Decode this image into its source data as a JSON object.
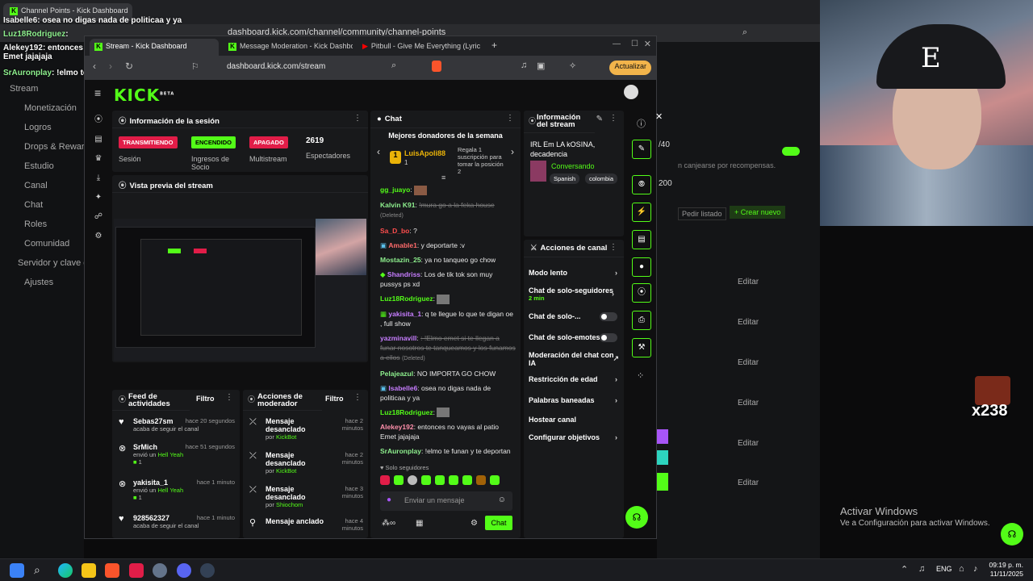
{
  "back_browser": {
    "tab_title": "Channel Points - Kick Dashboard",
    "url": "dashboard.kick.com/channel/community/channel-points"
  },
  "bg_sidebar": {
    "items": [
      "Stream",
      "Monetización",
      "Logros",
      "Drops & Rewards",
      "Estudio",
      "Canal",
      "Chat",
      "Roles",
      "Comunidad",
      "Servidor y clave de",
      "Ajustes"
    ]
  },
  "bg_right": {
    "count1": "/40",
    "count2": "200",
    "hint": "n canjearse por recompensas.",
    "pedir": "Pedir listado",
    "crear": "+ Crear nuevo",
    "editar": [
      "Editar",
      "Editar",
      "Editar",
      "Editar",
      "Editar",
      "Editar"
    ]
  },
  "overlay_chat": [
    {
      "user": "Isabelle6",
      "text": ": osea no digas nada de politicaa y ya"
    },
    {
      "user": "Luz18Rodriguez",
      "text": ":"
    },
    {
      "user": "Alekey192",
      "text": ": entonces no vayas al patio Emet jajajaja"
    },
    {
      "user": "SrAuronplay",
      "text": ": !elmo te funan y te deportan"
    }
  ],
  "front_browser": {
    "tabs": [
      "Stream - Kick Dashboard",
      "Message Moderation - Kick Dashboa",
      "Pitbull - Give Me Everything (Lyric"
    ],
    "url": "dashboard.kick.com/stream",
    "update": "Actualizar"
  },
  "session": {
    "title": "Información de la sesión",
    "stats": [
      {
        "badge": "TRANSMITIENDO",
        "label": "Sesión",
        "color": "#e11d48"
      },
      {
        "badge": "ENCENDIDO",
        "label": "Ingresos de Socio",
        "color": "#53fc18"
      },
      {
        "badge": "APAGADO",
        "label": "Multistream",
        "color": "#e11d48"
      },
      {
        "badge": "2619",
        "label": "Espectadores",
        "color": ""
      }
    ]
  },
  "preview": {
    "title": "Vista previa del stream"
  },
  "feed": {
    "title": "Feed de actividades",
    "filter": "Filtro",
    "items": [
      {
        "name": "Sebas27sm",
        "time": "hace 20 segundos",
        "desc": "acaba de seguir el canal",
        "extra": ""
      },
      {
        "name": "SrMich",
        "time": "hace 51 segundos",
        "desc": "envió un",
        "extra": "Hell Yeah",
        "count": "1"
      },
      {
        "name": "yakisita_1",
        "time": "hace 1 minuto",
        "desc": "envió un",
        "extra": "Hell Yeah",
        "count": "1"
      },
      {
        "name": "928562327",
        "time": "hace 1 minuto",
        "desc": "acaba de seguir el canal",
        "extra": ""
      }
    ]
  },
  "modactions": {
    "title": "Acciones de moderador",
    "filter": "Filtro",
    "items": [
      {
        "action": "Mensaje desanclado",
        "by": "KickBot",
        "time": "hace 2 minutos"
      },
      {
        "action": "Mensaje desanclado",
        "by": "KickBot",
        "time": "hace 2 minutos"
      },
      {
        "action": "Mensaje desanclado",
        "by": "Shiochom",
        "time": "hace 3 minutos"
      },
      {
        "action": "Mensaje anclado",
        "by": "",
        "time": "hace 4 minutos"
      }
    ]
  },
  "chat": {
    "title": "Chat",
    "donors_title": "Mejores donadores de la semana",
    "donor_name": "LuisApoli88",
    "donor_count": "1",
    "donor_desc": "Regala 1 suscripción para tomar la posición 2",
    "messages": [
      {
        "user": "gg_juayo",
        "text": ":",
        "color": "#53fc18",
        "deleted": false
      },
      {
        "user": "Kalvin K91",
        "text": "!mura go a la feka house",
        "color": "#8ef08e",
        "deleted": true
      },
      {
        "user": "Sa_D_bo",
        "text": "?",
        "color": "#ff4d4d",
        "deleted": false
      },
      {
        "user": "Amable1",
        "text": ": y deportarte :v",
        "color": "#ff6b6b",
        "deleted": false
      },
      {
        "user": "Mostazin_25",
        "text": ": ya no tanqueo go chow",
        "color": "#8ef08e",
        "deleted": false
      },
      {
        "user": "Shandriss",
        "text": ": Los de tik tok son muy pussys ps xd",
        "color": "#c77dff",
        "deleted": false
      },
      {
        "user": "Luz18Rodriguez",
        "text": ":",
        "color": "#53fc18",
        "deleted": false
      },
      {
        "user": "yakisita_1",
        "text": ": q te llegue lo que te digan oe , full show",
        "color": "#c77dff",
        "deleted": false
      },
      {
        "user": "yazminavill",
        "text": ": !Elmo emet si te llegan a funar nosotros te tanqueamos y los funamos a ellos",
        "color": "#c77dff",
        "deleted": true
      },
      {
        "user": "Pelajeazul",
        "text": ": NO IMPORTA GO CHOW",
        "color": "#8ef08e",
        "deleted": false
      },
      {
        "user": "Isabelle6",
        "text": ": osea no digas nada de politicaa y ya",
        "color": "#c77dff",
        "deleted": false
      },
      {
        "user": "Luz18Rodriguez",
        "text": ":",
        "color": "#53fc18",
        "deleted": false
      },
      {
        "user": "Alekey192",
        "text": ": entonces no vayas al patio Emet jajajaja",
        "color": "#ff8fab",
        "deleted": false
      },
      {
        "user": "SrAuronplay",
        "text": ": !elmo te funan y te deportan",
        "color": "#8ef08e",
        "deleted": false
      }
    ],
    "deleted_tag": "(Deleted)",
    "mode": "Solo seguidores",
    "placeholder": "Enviar un mensaje",
    "send": "Chat"
  },
  "stream_info": {
    "title": "Información del stream",
    "stream_title": "IRL Em LA kOSINA, decadencia",
    "category": "Conversando",
    "tags": [
      "Spanish",
      "colombia"
    ]
  },
  "channel_actions": {
    "title": "Acciones de canal",
    "items": [
      {
        "label": "Modo lento",
        "type": "chevron",
        "sub": ""
      },
      {
        "label": "Chat de solo-seguidores",
        "type": "chevron",
        "sub": "2 min"
      },
      {
        "label": "Chat de solo-...",
        "type": "toggle",
        "sub": ""
      },
      {
        "label": "Chat de solo-emotes",
        "type": "toggle",
        "sub": ""
      },
      {
        "label": "Moderación del chat con IA",
        "type": "link",
        "sub": ""
      },
      {
        "label": "Restricción de edad",
        "type": "chevron",
        "sub": ""
      },
      {
        "label": "Palabras baneadas",
        "type": "chevron",
        "sub": ""
      },
      {
        "label": "Hostear canal",
        "type": "none",
        "sub": ""
      },
      {
        "label": "Configurar objetivos",
        "type": "chevron",
        "sub": ""
      }
    ]
  },
  "windows_watermark": {
    "title": "Activar Windows",
    "sub": "Ve a Configuración para activar Windows."
  },
  "overlay_counter": "x238",
  "taskbar": {
    "lang": "ENG",
    "time": "09:19 p. m.",
    "date": "11/11/2025"
  }
}
